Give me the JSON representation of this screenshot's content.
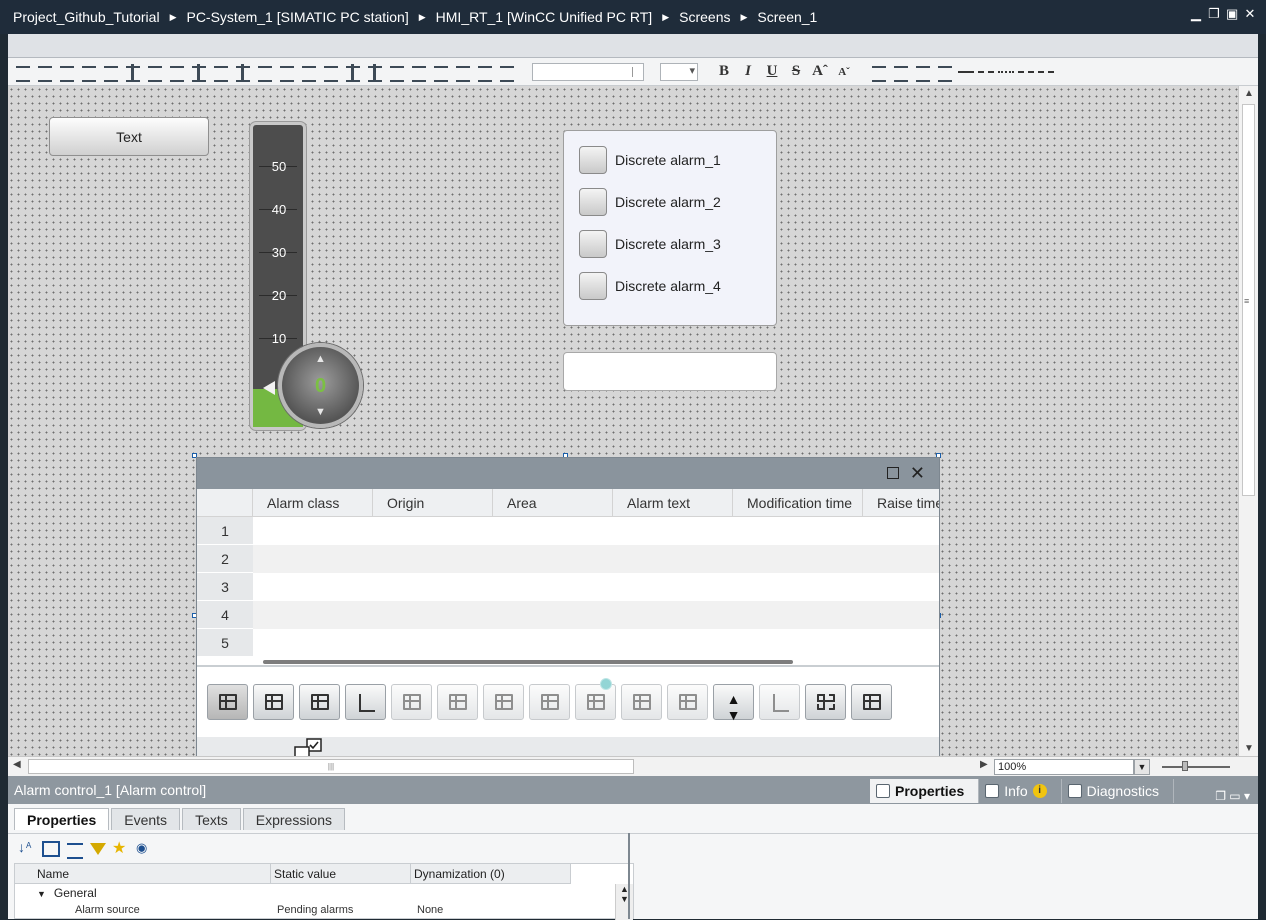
{
  "breadcrumb": [
    "Project_Github_Tutorial",
    "PC-System_1 [SIMATIC PC station]",
    "HMI_RT_1 [WinCC Unified PC RT]",
    "Screens",
    "Screen_1"
  ],
  "window_controls": [
    "minimize-icon",
    "restore-icon",
    "maximize-icon",
    "close-icon"
  ],
  "toolbar": {
    "font_field_value": "",
    "size_field_value": "",
    "bold": "B",
    "italic": "I",
    "underline": "U",
    "strike": "S",
    "grow": "Aˆ",
    "shrink": "Aˇ"
  },
  "canvas": {
    "text_button_label": "Text",
    "gauge": {
      "scale_labels": [
        "50",
        "40",
        "30",
        "20",
        "10"
      ],
      "value": "0",
      "fill_level": 0.0
    },
    "discrete_alarms": [
      "Discrete alarm_1",
      "Discrete alarm_2",
      "Discrete alarm_3",
      "Discrete alarm_4"
    ],
    "io_field_value": ""
  },
  "alarm_control": {
    "columns": [
      "Alarm class",
      "Origin",
      "Area",
      "Alarm text",
      "Modification time",
      "Raise time"
    ],
    "row_numbers": [
      "1",
      "2",
      "3",
      "4",
      "5"
    ]
  },
  "zoom": "100%",
  "bottom_panel": {
    "object_title": "Alarm control_1 [Alarm control]",
    "inspector_tabs": [
      "Properties",
      "Info",
      "Diagnostics"
    ],
    "active_inspector_tab": "Properties",
    "tabs": [
      "Properties",
      "Events",
      "Texts",
      "Expressions"
    ],
    "active_tab": "Properties",
    "table_headers": [
      "Name",
      "Static value",
      "Dynamization (0)"
    ],
    "tree_row": "General",
    "cut_row_name": "Alarm source",
    "cut_row_value": "Pending alarms",
    "cut_row_dyn": "None"
  },
  "colors": {
    "title_bar": "#1f2c3a",
    "gauge_fill": "#74b842",
    "knob_value": "#7bc043",
    "panel_header": "#8e979f",
    "selection_handle": "#1a5ea9"
  }
}
